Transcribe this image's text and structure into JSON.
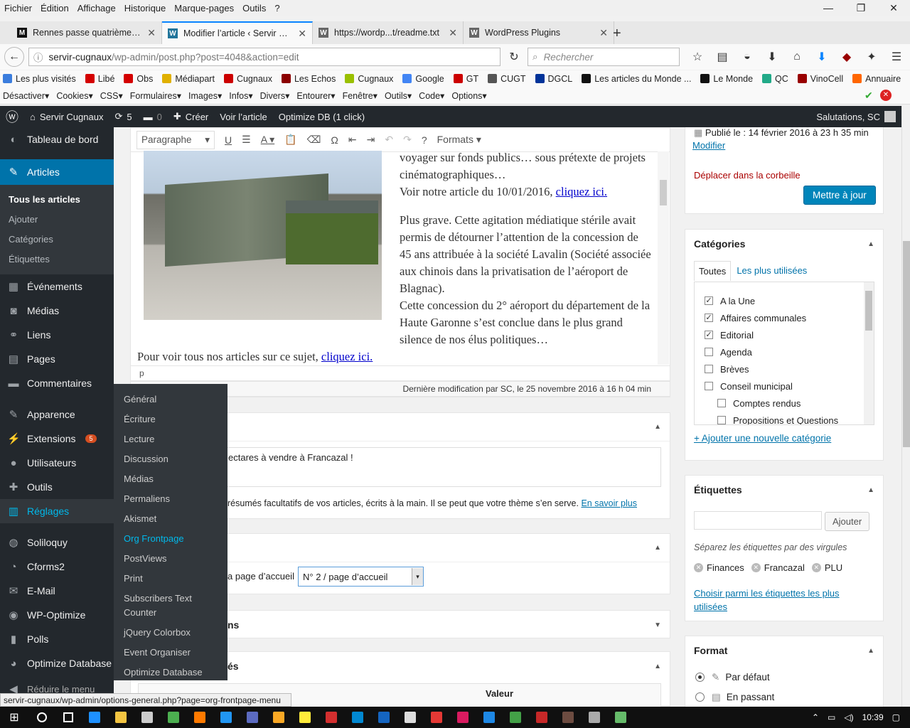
{
  "menubar": [
    "Fichier",
    "Édition",
    "Affichage",
    "Historique",
    "Marque-pages",
    "Outils",
    "?"
  ],
  "tabs": [
    {
      "title": "Rennes passe quatrième d...",
      "fav": "M",
      "color": "#111"
    },
    {
      "title": "Modifier l’article ‹ Servir C...",
      "fav": "W",
      "color": "#21759b"
    },
    {
      "title": "https://wordp...t/readme.txt",
      "fav": "W",
      "color": "#666"
    },
    {
      "title": "WordPress Plugins",
      "fav": "W",
      "color": "#666"
    }
  ],
  "url": {
    "host": "servir-cugnaux",
    "path": "/wp-admin/post.php?post=4048&action=edit"
  },
  "search_placeholder": "Rechercher",
  "bookmarks": [
    {
      "label": "Les plus visités",
      "color": "#3b7ddd"
    },
    {
      "label": "Libé",
      "color": "#d40000"
    },
    {
      "label": "Obs",
      "color": "#d40000"
    },
    {
      "label": "Médiapart",
      "color": "#e0b000"
    },
    {
      "label": "Cugnaux",
      "color": "#c00"
    },
    {
      "label": "Les Echos",
      "color": "#8b0000"
    },
    {
      "label": "Cugnaux",
      "color": "#9ac000"
    },
    {
      "label": "Google",
      "color": "#4285f4"
    },
    {
      "label": "GT",
      "color": "#c00"
    },
    {
      "label": "CUGT",
      "color": "#555"
    },
    {
      "label": "DGCL",
      "color": "#003399"
    },
    {
      "label": "Les articles du Monde ...",
      "color": "#111"
    },
    {
      "label": "Le Monde",
      "color": "#111"
    },
    {
      "label": "QC",
      "color": "#2a8"
    },
    {
      "label": "VinoCell",
      "color": "#900"
    },
    {
      "label": "Annuaire",
      "color": "#f60"
    }
  ],
  "devbar": [
    "Désactiver▾",
    "Cookies▾",
    "CSS▾",
    "Formulaires▾",
    "Images▾",
    "Infos▾",
    "Divers▾",
    "Entourer▾",
    "Fenêtre▾",
    "Outils▾",
    "Code▾",
    "Options▾"
  ],
  "adminbar": {
    "site": "Servir Cugnaux",
    "updates": "5",
    "comments": "0",
    "new": "Créer",
    "view": "Voir l’article",
    "optimize": "Optimize DB (1 click)",
    "greeting": "Salutations, SC"
  },
  "sidebar": {
    "top": "Tableau de bord",
    "articles": "Articles",
    "sub": [
      "Tous les articles",
      "Ajouter",
      "Catégories",
      "Étiquettes"
    ],
    "items": [
      {
        "label": "Événements",
        "icon": "▦"
      },
      {
        "label": "Médias",
        "icon": "◙"
      },
      {
        "label": "Liens",
        "icon": "⚭"
      },
      {
        "label": "Pages",
        "icon": "▤"
      },
      {
        "label": "Commentaires",
        "icon": "▬"
      }
    ],
    "items2": [
      {
        "label": "Apparence",
        "icon": "✎"
      },
      {
        "label": "Extensions",
        "icon": "⚡"
      },
      {
        "label": "Utilisateurs",
        "icon": "●"
      },
      {
        "label": "Outils",
        "icon": "✚"
      },
      {
        "label": "Réglages",
        "icon": "▥"
      }
    ],
    "items3": [
      {
        "label": "Soliloquy",
        "icon": "◍"
      },
      {
        "label": "Cforms2",
        "icon": "◔"
      },
      {
        "label": "E-Mail",
        "icon": "✉"
      },
      {
        "label": "WP-Optimize",
        "icon": "◉"
      },
      {
        "label": "Polls",
        "icon": "▮"
      },
      {
        "label": "Optimize Database",
        "icon": "◕"
      }
    ],
    "extensions_badge": "5",
    "collapse": "Réduire le menu"
  },
  "flyout": [
    "Général",
    "Écriture",
    "Lecture",
    "Discussion",
    "Médias",
    "Permaliens",
    "Akismet",
    "Org Frontpage",
    "PostViews",
    "Print",
    "Subscribers Text Counter",
    "jQuery Colorbox",
    "Event Organiser",
    "Optimize Database"
  ],
  "editor": {
    "format": "Paragraphe",
    "formats": "Formats",
    "p1": "voyager sur fonds publics… sous prétexte de projets cinématographiques…",
    "p1b": "Voir notre article du 10/01/2016,",
    "link": "cliquez ici.",
    "p2": "Plus grave. Cette agitation médiatique stérile avait permis de détourner l’attention de la concession de 45 ans attribuée à la société Lavalin (Société associée aux chinois dans la privatisation de l’aéroport de Blagnac).",
    "p3": "Cette concession du 2° aéroport du département de la Haute Garonne s’est conclue dans le plus grand silence de nos élus politiques…",
    "p4": "Pour voir tous nos articles sur ce sujet,",
    "link2": "cliquez ici.",
    "path": "p",
    "lastmod": "Dernière modification par SC, le 25 novembre 2016 à 16 h 04 min"
  },
  "excerpt": {
    "text": "ectares à vendre à Francazal !",
    "help": "résumés facultatifs de vos articles, écrits à la main. Il se peut que votre thème s’en serve.",
    "more": "En savoir plus"
  },
  "frontpage": {
    "label": "a page d’accueil",
    "value": "N° 2 / page d’accueil"
  },
  "box3": "ns",
  "box4": "és",
  "valeur": "Valeur",
  "publish": {
    "date_label": "Publié le : ",
    "date": "14 février 2016 à 23 h 35 min",
    "modify": "Modifier",
    "trash": "Déplacer dans la corbeille",
    "update": "Mettre à jour"
  },
  "categories": {
    "title": "Catégories",
    "tab_all": "Toutes",
    "tab_used": "Les plus utilisées",
    "items": [
      {
        "label": "A la Une",
        "checked": true,
        "indent": false
      },
      {
        "label": "Affaires communales",
        "checked": true,
        "indent": false
      },
      {
        "label": "Editorial",
        "checked": true,
        "indent": false
      },
      {
        "label": "Agenda",
        "checked": false,
        "indent": false
      },
      {
        "label": "Brèves",
        "checked": false,
        "indent": false
      },
      {
        "label": "Conseil municipal",
        "checked": false,
        "indent": false
      },
      {
        "label": "Comptes rendus",
        "checked": false,
        "indent": true
      },
      {
        "label": "Propositions et Questions",
        "checked": false,
        "indent": true
      }
    ],
    "add": "+ Ajouter une nouvelle catégorie"
  },
  "tags": {
    "title": "Étiquettes",
    "add": "Ajouter",
    "hint": "Séparez les étiquettes par des virgules",
    "items": [
      "Finances",
      "Francazal",
      "PLU"
    ],
    "choose": "Choisir parmi les étiquettes les plus utilisées"
  },
  "format": {
    "title": "Format",
    "opt1": "Par défaut",
    "opt2": "En passant"
  },
  "status_url": "servir-cugnaux/wp-admin/options-general.php?page=org-frontpage-menu",
  "clock": "10:39"
}
